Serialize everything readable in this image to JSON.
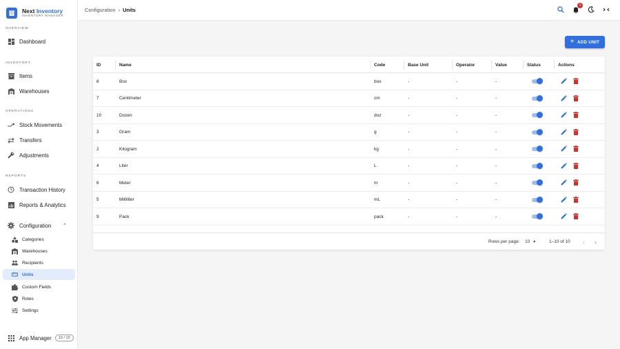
{
  "brand": {
    "title_part1": "Next",
    "title_part2": "Inventory",
    "subtitle": "INVENTORY MANAGER"
  },
  "sidebar": {
    "sections": {
      "overview": "OVERVIEW",
      "inventory": "INVENTORY",
      "operations": "OPERATIONS",
      "reports": "REPORTS"
    },
    "items": {
      "dashboard": "Dashboard",
      "items": "Items",
      "warehouses": "Warehouses",
      "stock_movements": "Stock Movements",
      "transfers": "Transfers",
      "adjustments": "Adjustments",
      "transaction_history": "Transaction History",
      "reports_analytics": "Reports & Analytics",
      "configuration": "Configuration"
    },
    "config_items": {
      "categories": "Categories",
      "warehouses": "Warehouses",
      "recipients": "Recipients",
      "units": "Units",
      "custom_fields": "Custom Fields",
      "roles": "Roles",
      "settings": "Settings"
    },
    "app_manager": {
      "label": "App Manager",
      "badge": "10 / 10"
    }
  },
  "header": {
    "breadcrumb": {
      "parent": "Configuration",
      "separator": "›",
      "current": "Units"
    },
    "notification_count": "1"
  },
  "toolbar": {
    "add_label": "ADD UNIT"
  },
  "table": {
    "columns": {
      "id": "ID",
      "name": "Name",
      "code": "Code",
      "base_unit": "Base Unit",
      "operator": "Operator",
      "value": "Value",
      "status": "Status",
      "actions": "Actions"
    },
    "rows": [
      {
        "id": "8",
        "name": "Box",
        "code": "box",
        "base_unit": "-",
        "operator": "-",
        "value": "-",
        "active": true
      },
      {
        "id": "7",
        "name": "Centimeter",
        "code": "cm",
        "base_unit": "-",
        "operator": "-",
        "value": "-",
        "active": true
      },
      {
        "id": "10",
        "name": "Dozen",
        "code": "doz",
        "base_unit": "-",
        "operator": "-",
        "value": "-",
        "active": true
      },
      {
        "id": "3",
        "name": "Gram",
        "code": "g",
        "base_unit": "-",
        "operator": "-",
        "value": "-",
        "active": true
      },
      {
        "id": "2",
        "name": "Kilogram",
        "code": "kg",
        "base_unit": "-",
        "operator": "-",
        "value": "-",
        "active": true
      },
      {
        "id": "4",
        "name": "Liter",
        "code": "L",
        "base_unit": "-",
        "operator": "-",
        "value": "-",
        "active": true
      },
      {
        "id": "6",
        "name": "Meter",
        "code": "m",
        "base_unit": "-",
        "operator": "-",
        "value": "-",
        "active": true
      },
      {
        "id": "5",
        "name": "Milliliter",
        "code": "mL",
        "base_unit": "-",
        "operator": "-",
        "value": "-",
        "active": true
      },
      {
        "id": "9",
        "name": "Pack",
        "code": "pack",
        "base_unit": "-",
        "operator": "-",
        "value": "-",
        "active": true
      }
    ],
    "pagination": {
      "rows_per_page_label": "Rows per page:",
      "rows_per_page": "10",
      "range": "1–10 of 10"
    }
  },
  "colors": {
    "accent": "#2f6fe0",
    "danger": "#d32f2f",
    "active_nav_bg": "#e3ecfb"
  }
}
